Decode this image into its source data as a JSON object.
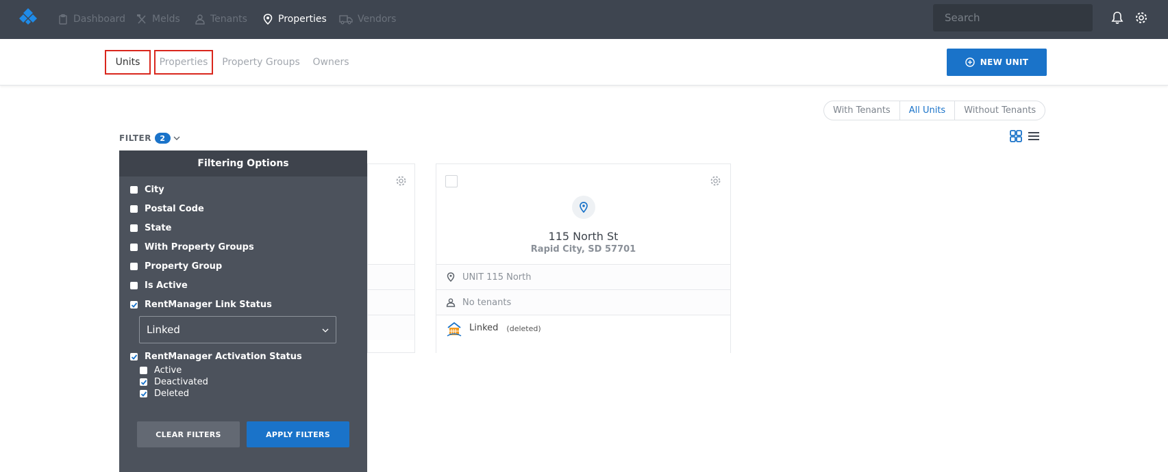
{
  "nav": {
    "items": [
      {
        "label": "Dashboard",
        "icon": "clipboard-icon",
        "active": false
      },
      {
        "label": "Melds",
        "icon": "tools-icon",
        "active": false
      },
      {
        "label": "Tenants",
        "icon": "person-icon",
        "active": false
      },
      {
        "label": "Properties",
        "icon": "map-pin-icon",
        "active": true
      },
      {
        "label": "Vendors",
        "icon": "truck-icon",
        "active": false
      }
    ],
    "search_placeholder": "Search"
  },
  "subnav": {
    "tabs": [
      "Units",
      "Properties",
      "Property Groups",
      "Owners"
    ],
    "new_unit_label": "NEW UNIT"
  },
  "toggle": {
    "options": [
      "With Tenants",
      "All Units",
      "Without Tenants"
    ],
    "selected": "All Units"
  },
  "filter": {
    "label": "FILTER",
    "count": "2"
  },
  "panel": {
    "title": "Filtering Options",
    "options": [
      {
        "label": "City",
        "checked": false
      },
      {
        "label": "Postal Code",
        "checked": false
      },
      {
        "label": "State",
        "checked": false
      },
      {
        "label": "With Property Groups",
        "checked": false
      },
      {
        "label": "Property Group",
        "checked": false
      },
      {
        "label": "Is Active",
        "checked": false
      },
      {
        "label": "RentManager Link Status",
        "checked": true
      }
    ],
    "link_status_value": "Linked",
    "activation": {
      "label": "RentManager Activation Status",
      "checked": true,
      "sub": [
        {
          "label": "Active",
          "checked": false
        },
        {
          "label": "Deactivated",
          "checked": true
        },
        {
          "label": "Deleted",
          "checked": true
        }
      ]
    },
    "clear_label": "CLEAR FILTERS",
    "apply_label": "APPLY FILTERS"
  },
  "card": {
    "street": "115 North St",
    "city_line": "Rapid City, SD 57701",
    "unit": "UNIT 115 North",
    "tenants": "No tenants",
    "link_label": "Linked",
    "link_status": "(deleted)"
  },
  "colors": {
    "navbar": "#3e4550",
    "accent": "#1a73c9",
    "panel": "#4c525c",
    "highlight": "#d9261c"
  }
}
